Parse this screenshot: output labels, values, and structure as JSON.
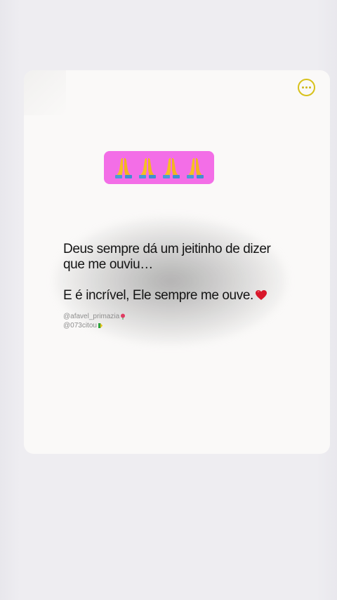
{
  "post": {
    "emoji_badge": {
      "icons": [
        "folded-hands",
        "folded-hands",
        "folded-hands",
        "folded-hands"
      ],
      "background": "#f36ee7"
    },
    "quote": {
      "line1": "Deus sempre dá um jeitinho de dizer",
      "line2": "que me ouviu…",
      "line3": "E é incrível, Ele sempre me ouve.",
      "line3_icon": "red-heart"
    },
    "credits": {
      "author": "@afavel_primazia",
      "author_icon": "rose",
      "reposter": "@073citou",
      "reposter_icon": "green-leaf"
    },
    "menu_icon": "more-horizontal",
    "accent_color": "#d8c21c"
  }
}
